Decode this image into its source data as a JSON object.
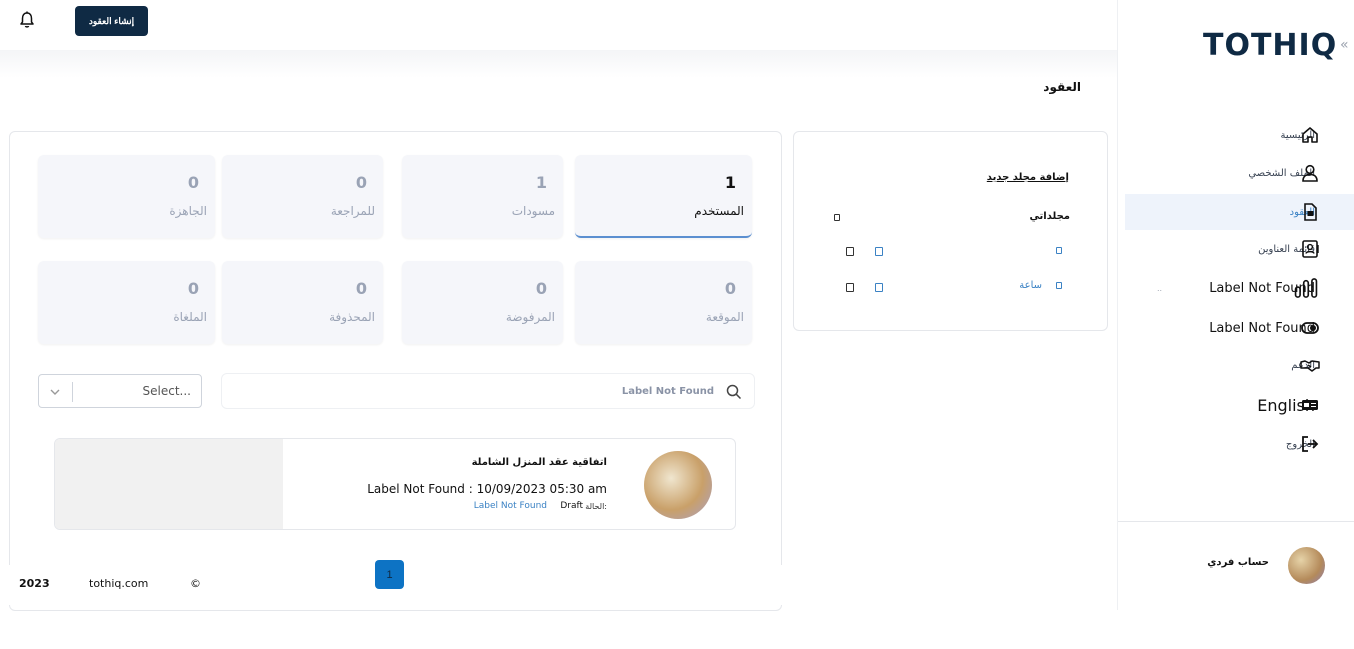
{
  "header": {
    "create_button": "إنشاء العقود",
    "page_title": "العقود"
  },
  "sidebar": {
    "logo": "TOTHIQ",
    "collapse_icon": "«",
    "items": [
      {
        "label": "الرئيسية",
        "icon": "home-icon"
      },
      {
        "label": "الملف الشخصي",
        "icon": "user-icon"
      },
      {
        "label": "العقود",
        "icon": "document-icon",
        "active": true
      },
      {
        "label": "قائمة العناوين",
        "icon": "contacts-icon"
      },
      {
        "label": "Label Not Found",
        "icon": "bar-chart-icon",
        "extra": ".."
      },
      {
        "label": "Label Not Found",
        "icon": "toggle-icon"
      },
      {
        "label": "الدعم",
        "icon": "handshake-icon"
      },
      {
        "label": "English",
        "icon": "language-icon"
      },
      {
        "label": "الخروج",
        "icon": "logout-icon"
      }
    ],
    "account_name": "حساب فردي"
  },
  "folders": {
    "add_folder": "إضافة مجلد جديد",
    "my_folders": "مجلداتي",
    "folder_name": "ساعة"
  },
  "stats": [
    {
      "value": "1",
      "label": "المستخدم",
      "active": true
    },
    {
      "value": "1",
      "label": "مسودات"
    },
    {
      "value": "0",
      "label": "للمراجعة"
    },
    {
      "value": "0",
      "label": "الجاهزة"
    },
    {
      "value": "0",
      "label": "الموقعة"
    },
    {
      "value": "0",
      "label": "المرفوضة"
    },
    {
      "value": "0",
      "label": "المحذوفة"
    },
    {
      "value": "0",
      "label": "الملغاة"
    }
  ],
  "filters": {
    "search_placeholder": "Label Not Found",
    "select_value": "Select..."
  },
  "contract": {
    "title": "اتفاقية عقد المنزل الشاملة",
    "date_line": "Label Not Found : 10/09/2023 05:30 am",
    "status_label": "الحالة:",
    "status": "Draft",
    "link": "Label Not Found"
  },
  "pagination": {
    "current": "1"
  },
  "footer": {
    "year": "2023",
    "site": "tothiq.com",
    "copyright": "©"
  },
  "colors": {
    "brand": "#0f2a44",
    "accent": "#3b82c4",
    "active_bg": "#eef3fb",
    "page_button": "#0d73c4"
  }
}
